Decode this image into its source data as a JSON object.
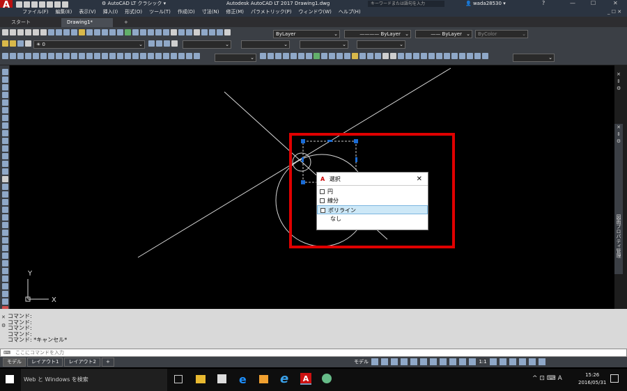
{
  "app": {
    "title": "Autodesk AutoCAD LT 2017   Drawing1.dwg",
    "workspace": "AutoCAD LT クラシック",
    "search_placeholder": "キーワードまたは語句を入力",
    "user": "wada28530",
    "logo": "A",
    "logo_sub": "LT"
  },
  "menu": [
    "ファイル(F)",
    "編集(E)",
    "表示(V)",
    "挿入(I)",
    "形式(O)",
    "ツール(T)",
    "作成(D)",
    "寸法(N)",
    "修正(M)",
    "パラメトリック(P)",
    "ウィンドウ(W)",
    "ヘルプ(H)"
  ],
  "tabs": {
    "start": "スタート",
    "drawing": "Drawing1*",
    "add": "+"
  },
  "properties": {
    "layer_color": "ByLayer",
    "linetype": "ByLayer",
    "lineweight": "ByLayer",
    "plotstyle": "ByColor",
    "layer": "0"
  },
  "selection_popup": {
    "title": "選択",
    "items": [
      "円",
      "線分",
      "ポリライン",
      "なし"
    ],
    "selected_index": 2
  },
  "ucs": {
    "y": "Y",
    "x": "X"
  },
  "palette_label": "図面プロパティ管理",
  "command": {
    "history": [
      "コマンド:",
      "コマンド:",
      "コマンド:",
      "コマンド:",
      "コマンド: *キャンセル*"
    ],
    "placeholder": "ここにコマンドを入力",
    "prompt_icon": "⌨"
  },
  "layout_tabs": [
    "モデル",
    "レイアウト1",
    "レイアウト2",
    "+"
  ],
  "status": {
    "model": "モデル",
    "scale": "1:1"
  },
  "taskbar": {
    "search": "Web と Windows を検索",
    "time": "15:26",
    "date": "2016/05/31",
    "ime": "A"
  },
  "colors": {
    "accent_red": "#e00000",
    "grip_blue": "#1a6cd6",
    "title_bar": "#2b3441",
    "toolbar": "#3b3f45"
  }
}
